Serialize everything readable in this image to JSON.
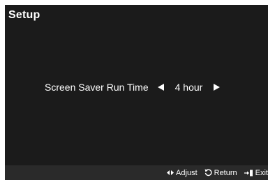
{
  "header": {
    "title": "Setup"
  },
  "setting": {
    "label": "Screen Saver Run Time",
    "value": "4 hour",
    "left_arrow_icon": "left-triangle-icon",
    "right_arrow_icon": "right-triangle-icon"
  },
  "footer": {
    "hints": [
      {
        "icon": "left-right-arrows-icon",
        "label": "Adjust"
      },
      {
        "icon": "return-icon",
        "label": "Return"
      },
      {
        "icon": "exit-icon",
        "label": "Exit"
      }
    ]
  },
  "colors": {
    "background": "#1b1b1b",
    "footer_background": "#2a2a2a",
    "text": "#ffffff"
  }
}
